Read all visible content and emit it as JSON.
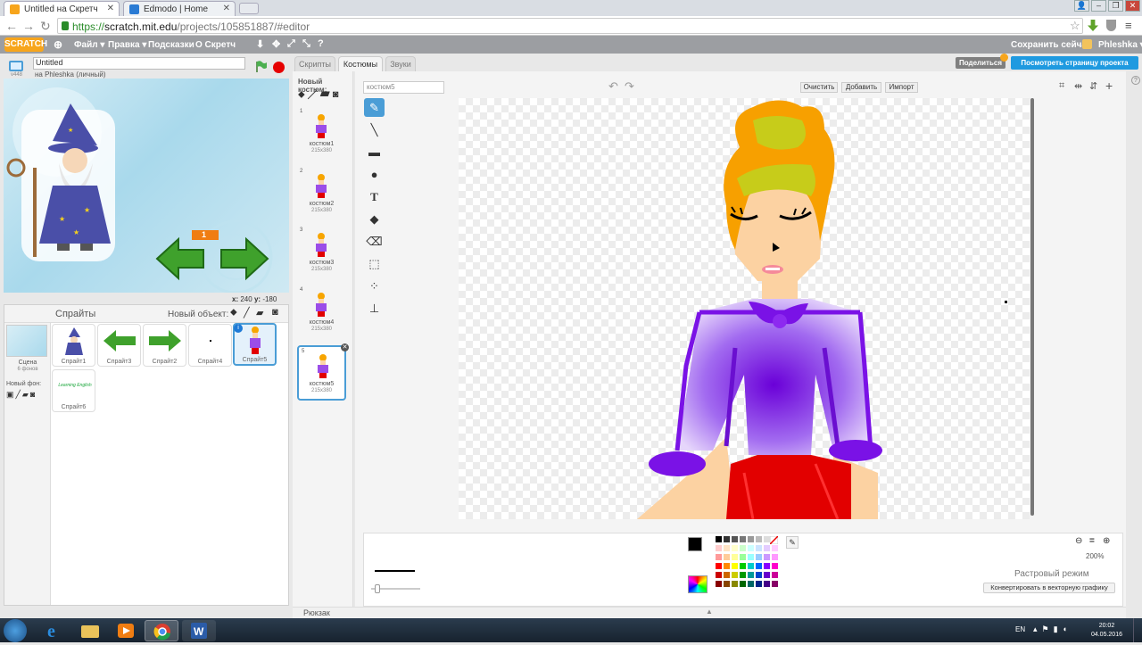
{
  "browser": {
    "tabs": [
      {
        "title": "Untitled на Скретч",
        "active": true
      },
      {
        "title": "Edmodo | Home",
        "active": false
      }
    ],
    "url_scheme": "https://",
    "url_host": "scratch.mit.edu",
    "url_path": "/projects/105851887/#editor"
  },
  "menubar": {
    "logo": "SCRATCH",
    "file": "Файл ▾",
    "edit": "Правка ▾",
    "tips": "Подсказки",
    "about": "О Скретч",
    "save_now": "Сохранить сейчас",
    "user": "Phleshka ▾"
  },
  "stage_header": {
    "version": "v448",
    "project_title": "Untitled",
    "owner": "на Phleshka (личный)"
  },
  "stage": {
    "counter_value": "1",
    "coords_x_label": "x:",
    "coords_x": "240",
    "coords_y_label": "y:",
    "coords_y": "-180"
  },
  "sprites_panel": {
    "title": "Спрайты",
    "new_object": "Новый объект:",
    "scene_label": "Сцена",
    "scene_backdrops": "6 фонов",
    "new_backdrop": "Новый фон:",
    "sprites": [
      {
        "name": "Спрайт1"
      },
      {
        "name": "Спрайт3"
      },
      {
        "name": "Спрайт2"
      },
      {
        "name": "Спрайт4"
      },
      {
        "name": "Спрайт5",
        "selected": true
      },
      {
        "name": "Спрайт6",
        "thumb_text": "Learning English"
      }
    ]
  },
  "editor_tabs": {
    "scripts": "Скрипты",
    "costumes": "Костюмы",
    "sounds": "Звуки"
  },
  "actions": {
    "share": "Поделиться",
    "view_project_page": "Посмотреть страницу проекта"
  },
  "costumes_panel": {
    "new_costume": "Новый костюм:",
    "items": [
      {
        "num": "1",
        "name": "костюм1",
        "size": "215x380"
      },
      {
        "num": "2",
        "name": "костюм2",
        "size": "215x380"
      },
      {
        "num": "3",
        "name": "костюм3",
        "size": "215x380"
      },
      {
        "num": "4",
        "name": "костюм4",
        "size": "215x380"
      },
      {
        "num": "5",
        "name": "костюм5",
        "size": "215x380",
        "selected": true
      }
    ]
  },
  "paint_editor": {
    "costume_name_value": "костюм5",
    "clear": "Очистить",
    "add": "Добавить",
    "import": "Импорт",
    "zoom": "200%",
    "mode": "Растровый режим",
    "convert": "Конвертировать в векторную графику",
    "selected_color": "#000000",
    "palette": [
      "#000000",
      "#333333",
      "#555555",
      "#777777",
      "#999999",
      "#bbbbbb",
      "#dddddd",
      "#ffffff",
      "#ffcccc",
      "#ffe4c4",
      "#ffffcc",
      "#ccffcc",
      "#ccffff",
      "#cce4ff",
      "#e4ccff",
      "#ffccff",
      "#ff9999",
      "#ffcc99",
      "#ffff99",
      "#99ff99",
      "#99ffff",
      "#99ccff",
      "#cc99ff",
      "#ff99ff",
      "#ff0000",
      "#ff8800",
      "#ffff00",
      "#00cc00",
      "#00cccc",
      "#0066ff",
      "#8800ff",
      "#ff00cc",
      "#cc0000",
      "#cc6600",
      "#cccc00",
      "#009900",
      "#009999",
      "#0044cc",
      "#6600cc",
      "#cc0099",
      "#880000",
      "#884400",
      "#888800",
      "#006600",
      "#006666",
      "#002288",
      "#440088",
      "#880066"
    ]
  },
  "backpack": {
    "label": "Рюкзак"
  },
  "taskbar": {
    "lang": "EN",
    "time": "20:02",
    "date": "04.05.2016"
  }
}
